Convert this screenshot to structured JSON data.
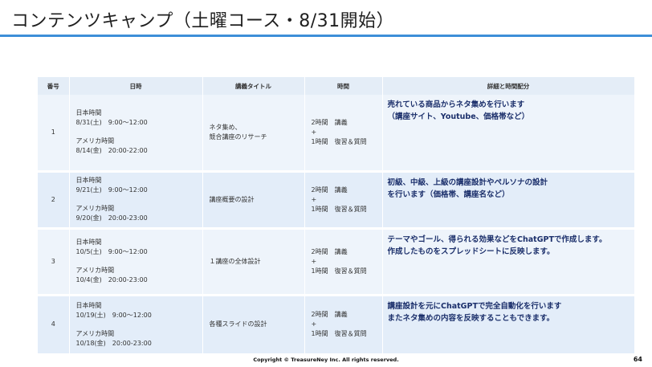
{
  "title": "コンテンツキャンプ（土曜コース・8/31開始）",
  "headers": [
    "番号",
    "日時",
    "講義タイトル",
    "時間",
    "詳細と時間配分"
  ],
  "rows": [
    {
      "num": "1",
      "jp_label": "日本時間",
      "jp_time": "8/31(土)　9:00～12:00",
      "us_label": "アメリカ時間",
      "us_time": "8/14(金)　20:00-22:00",
      "title_lines": [
        "ネタ集め、",
        "競合講座のリサーチ"
      ],
      "time_lines": [
        "2時間　講義",
        "+",
        "1時間　復習＆質問"
      ],
      "detail_lines": [
        "売れている商品からネタ集めを行います",
        "（講座サイト、Youtube、価格帯など）"
      ]
    },
    {
      "num": "2",
      "jp_label": "日本時間",
      "jp_time": "9/21(土)　9:00～12:00",
      "us_label": "アメリカ時間",
      "us_time": "9/20(金)　20:00-23:00",
      "title_lines": [
        "講座概要の設計"
      ],
      "time_lines": [
        "2時間　講義",
        "+",
        "1時間　復習＆質問"
      ],
      "detail_lines": [
        "初級、中級、上級の講座設計やペルソナの設計",
        "を行います（価格帯、講座名など）"
      ]
    },
    {
      "num": "3",
      "jp_label": "日本時間",
      "jp_time": "10/5(土)　9:00～12:00",
      "us_label": "アメリカ時間",
      "us_time": "10/4(金)　20:00-23:00",
      "title_lines": [
        "１講座の全体設計"
      ],
      "time_lines": [
        "2時間　講義",
        "+",
        "1時間　復習＆質問"
      ],
      "detail_lines": [
        "テーマやゴール、得られる効果などをChatGPTで作成します。",
        "作成したものをスプレッドシートに反映します。"
      ]
    },
    {
      "num": "4",
      "jp_label": "日本時間",
      "jp_time": "10/19(土)　9:00～12:00",
      "us_label": "アメリカ時間",
      "us_time": "10/18(金)　20:00-23:00",
      "title_lines": [
        "各種スライドの設計"
      ],
      "time_lines": [
        "2時間　講義",
        "+",
        "1時間　復習＆質問"
      ],
      "detail_lines": [
        "講座設計を元にChatGPTで完全自動化を行います",
        "またネタ集めの内容を反映することもできます。"
      ]
    }
  ],
  "copyright": "Copyright © TreasureNey Inc. All rights reserved.",
  "page_number": "64"
}
